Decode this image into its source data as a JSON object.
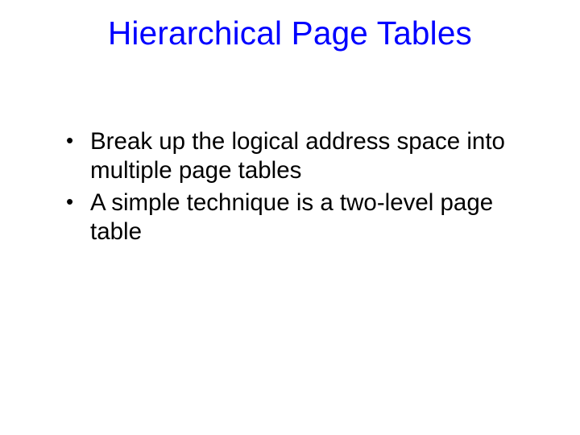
{
  "slide": {
    "title": "Hierarchical Page Tables",
    "bullets": [
      "Break up the logical address space into multiple page tables",
      "A simple technique is a two-level page table"
    ]
  }
}
